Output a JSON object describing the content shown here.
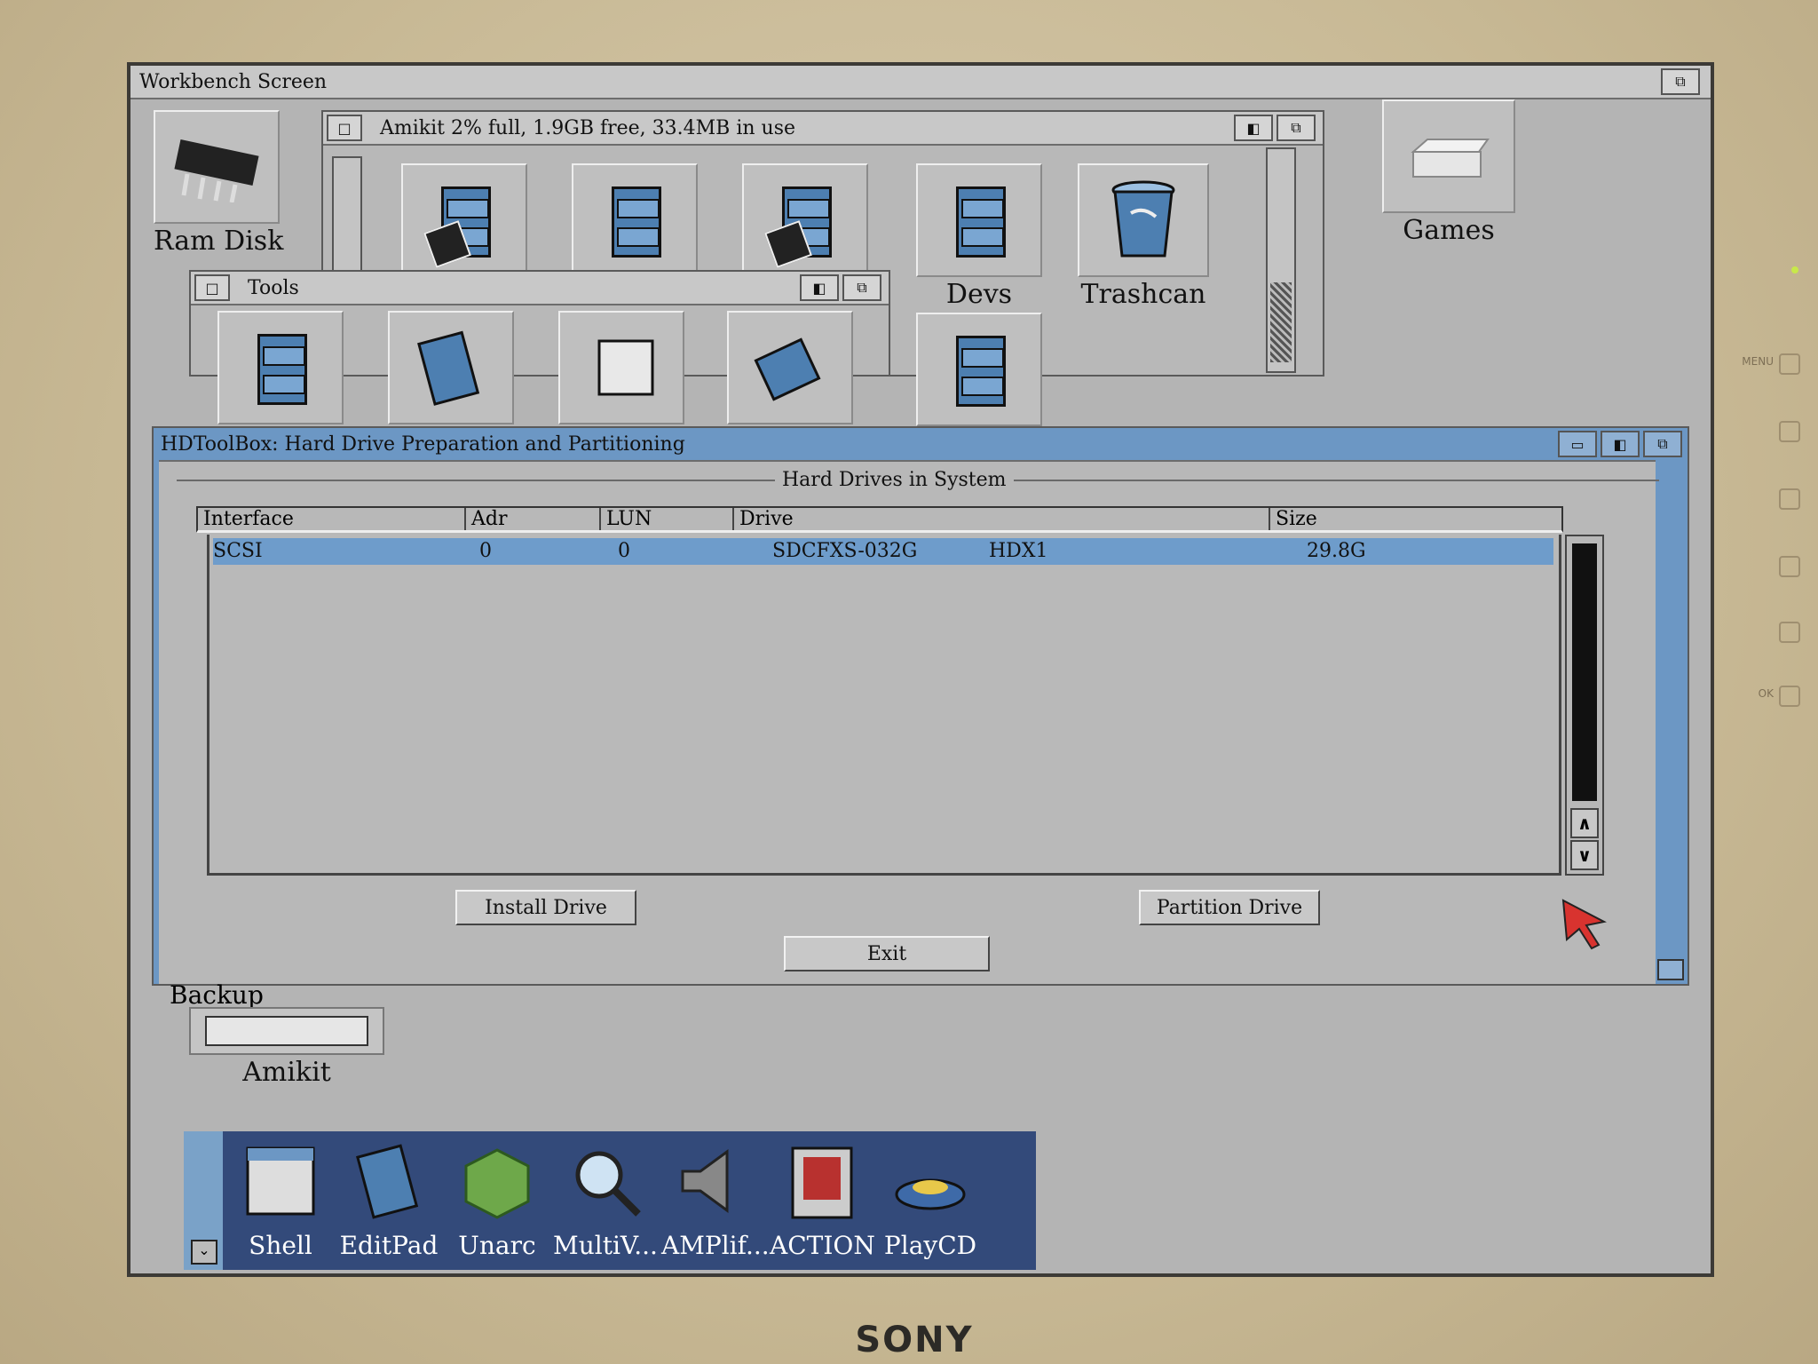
{
  "screen_title": "Workbench Screen",
  "desktop_icons": {
    "ram_disk": "Ram Disk",
    "games": "Games",
    "backup": "Backup",
    "amikit": "Amikit"
  },
  "amikit_window": {
    "title": "Amikit  2% full, 1.9GB free, 33.4MB in use",
    "icons": {
      "devs": "Devs",
      "trashcan": "Trashcan"
    }
  },
  "tools_window": {
    "title": "Tools"
  },
  "hdtoolbox": {
    "title": "HDToolBox: Hard Drive Preparation and Partitioning",
    "group_label": "Hard Drives in System",
    "columns": [
      "Interface",
      "Adr",
      "LUN",
      "Drive",
      "Size"
    ],
    "rows": [
      {
        "interface": "SCSI",
        "adr": "0",
        "lun": "0",
        "drive": "SDCFXS-032G",
        "drive2": "HDX1",
        "size": "29.8G"
      }
    ],
    "buttons": {
      "install": "Install Drive",
      "partition": "Partition Drive",
      "exit": "Exit"
    }
  },
  "dock": {
    "items": [
      "Shell",
      "EditPad",
      "Unarc",
      "MultiV...",
      "AMPlif...",
      "ACTION",
      "PlayCD"
    ]
  },
  "monitor": {
    "brand": "SONY",
    "controls": [
      "MENU",
      "OK"
    ]
  },
  "colors": {
    "active_title": "#6c97c4",
    "selection": "#6e9ccb",
    "dock": "#334a7a"
  }
}
